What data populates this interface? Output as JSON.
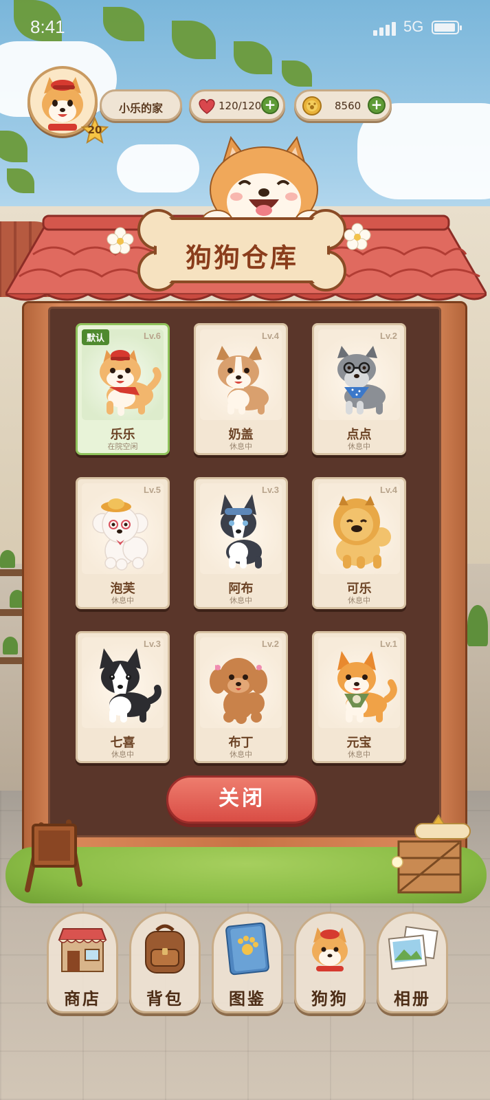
{
  "status_bar": {
    "time": "8:41",
    "network": "5G"
  },
  "hud": {
    "player_level": "20",
    "home_name": "小乐的家",
    "hearts": "120/120",
    "coins": "8560",
    "plus_label": "+"
  },
  "warehouse": {
    "title": "狗狗仓库",
    "default_badge": "默认",
    "dogs": [
      {
        "name": "乐乐",
        "level": "Lv.6",
        "status": "在院空闲",
        "selected": true,
        "colors": {
          "body": "#f2b66d",
          "accent": "#d63a2f"
        }
      },
      {
        "name": "奶盖",
        "level": "Lv.4",
        "status": "休息中",
        "selected": false,
        "colors": {
          "body": "#d9a06e",
          "accent": "#ffffff"
        }
      },
      {
        "name": "点点",
        "level": "Lv.2",
        "status": "休息中",
        "selected": false,
        "colors": {
          "body": "#8b8f95",
          "accent": "#3b78c9"
        }
      },
      {
        "name": "泡芙",
        "level": "Lv.5",
        "status": "休息中",
        "selected": false,
        "colors": {
          "body": "#fbf6f2",
          "accent": "#e8a33a"
        }
      },
      {
        "name": "阿布",
        "level": "Lv.3",
        "status": "休息中",
        "selected": false,
        "colors": {
          "body": "#3b3f4a",
          "accent": "#5d87b8"
        }
      },
      {
        "name": "可乐",
        "level": "Lv.4",
        "status": "休息中",
        "selected": false,
        "colors": {
          "body": "#f2c26c",
          "accent": "#e8a847"
        }
      },
      {
        "name": "七喜",
        "level": "Lv.3",
        "status": "休息中",
        "selected": false,
        "colors": {
          "body": "#2c2c30",
          "accent": "#ffffff"
        }
      },
      {
        "name": "布丁",
        "level": "Lv.2",
        "status": "休息中",
        "selected": false,
        "colors": {
          "body": "#c9824a",
          "accent": "#f08cb0"
        }
      },
      {
        "name": "元宝",
        "level": "Lv.1",
        "status": "休息中",
        "selected": false,
        "colors": {
          "body": "#f0a247",
          "accent": "#6f8f4f"
        }
      }
    ],
    "close_label": "关闭"
  },
  "nav": {
    "items": [
      {
        "label": "商店",
        "icon": "shop-icon"
      },
      {
        "label": "背包",
        "icon": "backpack-icon"
      },
      {
        "label": "图鉴",
        "icon": "book-icon"
      },
      {
        "label": "狗狗",
        "icon": "dog-icon"
      },
      {
        "label": "相册",
        "icon": "album-icon"
      }
    ]
  },
  "colors": {
    "roof": "#d9534f",
    "close_button": "#e0574d",
    "selected_card": "#8fc25b",
    "wood_frame": "#c97446"
  }
}
